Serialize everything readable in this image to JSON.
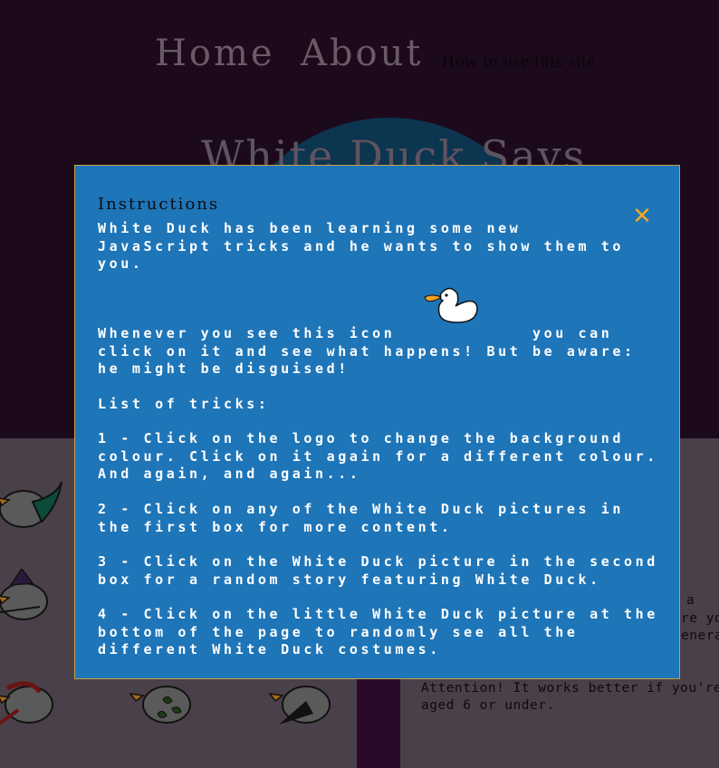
{
  "nav": {
    "home": "Home",
    "about": "About",
    "how_to": "How to use this site"
  },
  "hero": {
    "title": "White Duck Says"
  },
  "right_panel": {
    "partial_line_1": "a",
    "partial_line_2": "re yo",
    "partial_line_3": "enera",
    "attention": "Attention! It works better if you're\naged 6 or under."
  },
  "modal": {
    "title": "Instructions",
    "close_icon": "close-icon",
    "intro": "White Duck has been learning some new\nJavaScript tricks and he wants to show them to\nyou.",
    "whenever": "Whenever you see this icon            you can\nclick on it and see what happens! But be aware:\nhe might be disguised!",
    "list_heading": "List of tricks:",
    "trick_1": "1 - Click on the logo to change the background\ncolour. Click on it again for a different colour.\nAnd again, and again...",
    "trick_2": "2 - Click on any of the White Duck pictures in\nthe first box for more content.",
    "trick_3": "3 - Click on the White Duck picture in the second\nbox for a random story featuring White Duck.",
    "trick_4": "4 - Click on the little White Duck picture at the\nbottom of the page to randomly see all the\ndifferent White Duck costumes.",
    "duck_icon": "white-duck-icon"
  },
  "colors": {
    "modal_bg": "#1e75b8",
    "modal_border": "#c7a24a",
    "close": "#f0a52a",
    "page_bg": "#1c0a1c"
  }
}
